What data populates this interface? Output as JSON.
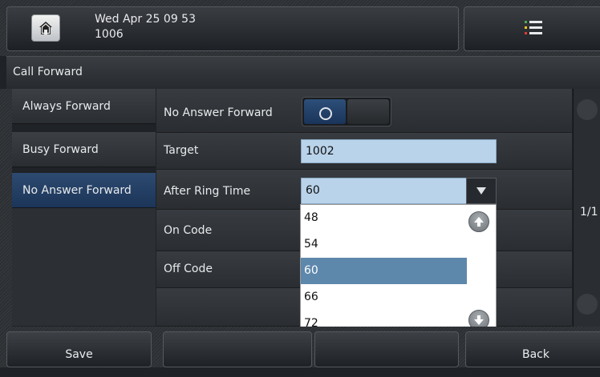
{
  "status_bar": {
    "datetime": "Wed Apr 25 09 53",
    "account": "1006",
    "home_icon": "home-icon",
    "menu_icon": "menu-list-icon",
    "menu_icon_colors": [
      "#4caf50",
      "#f5c518",
      "#e53935"
    ]
  },
  "title": "Call Forward",
  "sidebar": {
    "items": [
      {
        "label": "Always Forward"
      },
      {
        "label": "Busy Forward"
      },
      {
        "label": "No Answer Forward",
        "active": true
      }
    ]
  },
  "form": {
    "rows": [
      {
        "label": "No Answer Forward"
      },
      {
        "label": "Target"
      },
      {
        "label": "After Ring Time"
      },
      {
        "label": "On Code"
      },
      {
        "label": "Off Code"
      }
    ],
    "toggle_state": "off",
    "target_value": "1002",
    "ring_time_value": "60"
  },
  "dropdown": {
    "options": [
      "48",
      "54",
      "60",
      "66",
      "72"
    ],
    "selected": "60",
    "up_icon": "arrow-up-icon",
    "down_icon": "arrow-down-icon"
  },
  "pager": {
    "indicator": "1/1"
  },
  "softkeys": {
    "save": "Save",
    "blank1": "",
    "blank2": "",
    "back": "Back"
  },
  "colors": {
    "accent_blue": "#1c3559",
    "input_bg": "#b9d3ea",
    "selected_option": "#5e87ac"
  }
}
